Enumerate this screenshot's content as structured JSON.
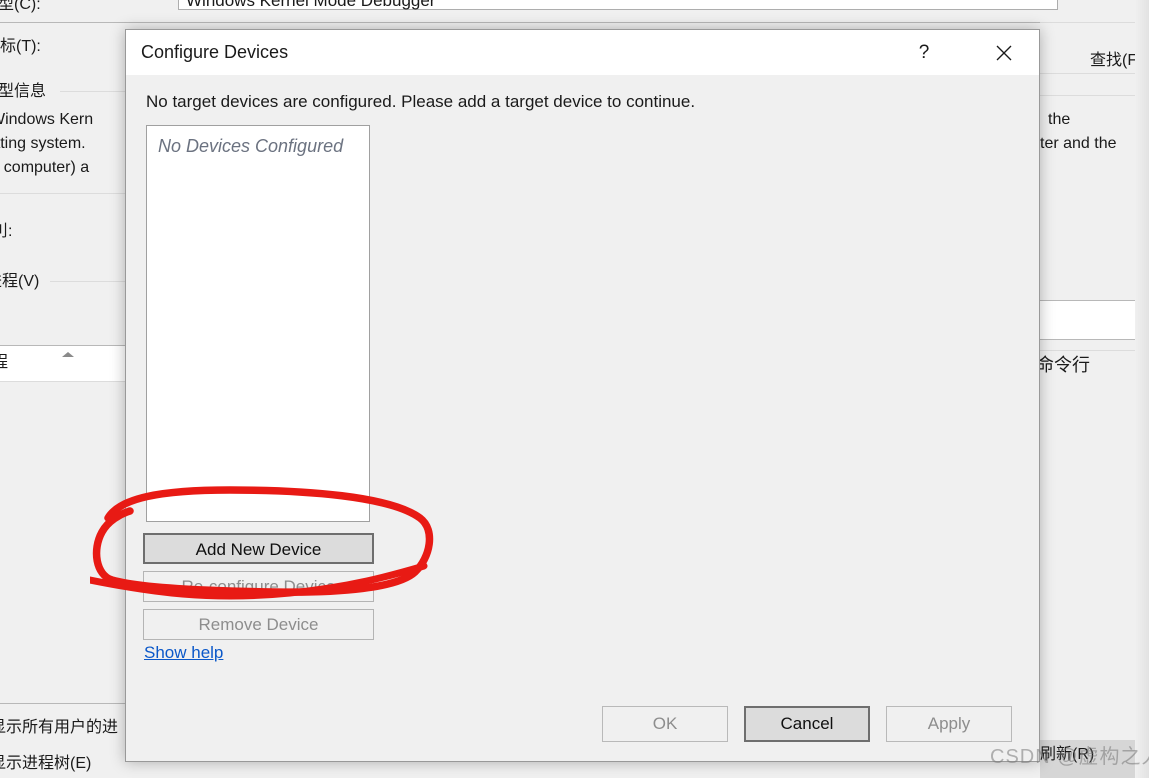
{
  "background": {
    "window_title": "",
    "combo_value": "Windows Kernel Mode Debugger",
    "labels": {
      "connection_type": "类型(C):",
      "target": "目标(T):",
      "type_info_group": "类型信息",
      "desc_line1": "Windows Kern",
      "desc_line2": "rating system.",
      "desc_line3": "et computer) a",
      "series_label": "刂:",
      "process_label": "进程(V)",
      "list_header": "程",
      "show_all_users": "显示所有用户的进",
      "show_process_tree": "显示进程树(E)",
      "find_button": "查找(F)",
      "right_text_1": "the",
      "right_text_2": "ter and the",
      "command_line": "命令行",
      "refresh_button": "刷新(R)"
    }
  },
  "dialog": {
    "title": "Configure Devices",
    "help_icon": "?",
    "close_icon": "✕",
    "message": "No target devices are configured. Please add a target device to continue.",
    "device_list": {
      "empty_text": "No Devices Configured",
      "items": []
    },
    "side_buttons": [
      {
        "label": "Add New Device",
        "state": "default",
        "name": "add-new-device-button"
      },
      {
        "label": "Re-configure Device",
        "state": "disabled",
        "name": "re-configure-device-button"
      },
      {
        "label": "Remove Device",
        "state": "disabled",
        "name": "remove-device-button"
      }
    ],
    "help_link": "Show help",
    "footer_buttons": [
      {
        "label": "OK",
        "state": "disabled"
      },
      {
        "label": "Cancel",
        "state": "default"
      },
      {
        "label": "Apply",
        "state": "disabled"
      }
    ]
  },
  "annotation": {
    "type": "hand-drawn-red-ellipse",
    "color": "#e81a14",
    "target": "Add New Device"
  },
  "watermark": {
    "text": "CSDN @虚构之人"
  },
  "colors": {
    "dialog_bg": "#f0f0f0",
    "titlebar_bg": "#ffffff",
    "listbox_bg": "#ffffff",
    "link": "#0b58c9",
    "annotation_red": "#e81a14",
    "disabled_text": "#8d8d8d"
  }
}
